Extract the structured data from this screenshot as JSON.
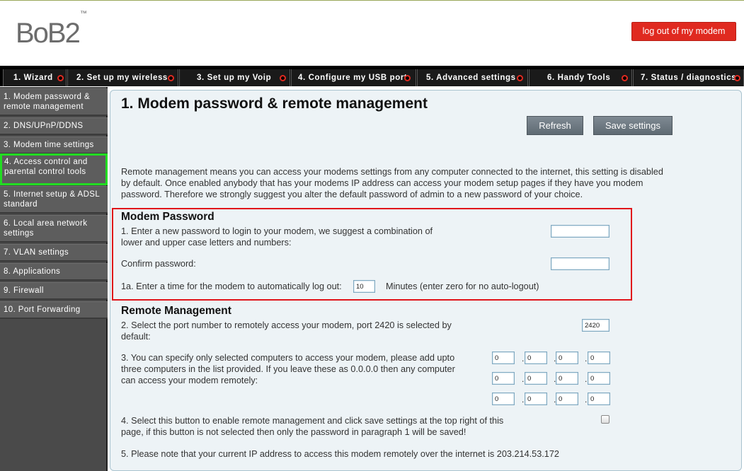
{
  "header": {
    "logo_text": "BoB2",
    "logo_tm": "™",
    "logout_label": "log out of my modem"
  },
  "nav": {
    "tabs": [
      {
        "label": "1. Wizard"
      },
      {
        "label": "2. Set up my wireless"
      },
      {
        "label": "3. Set up my Voip"
      },
      {
        "label": "4. Configure my USB port"
      },
      {
        "label": "5. Advanced settings"
      },
      {
        "label": "6. Handy Tools"
      },
      {
        "label": "7. Status / diagnostics"
      }
    ]
  },
  "sidebar": {
    "items": [
      {
        "label": "1. Modem password & remote management"
      },
      {
        "label": "2. DNS/UPnP/DDNS"
      },
      {
        "label": "3. Modem time settings"
      },
      {
        "label": "4. Access control and parental control tools"
      },
      {
        "label": "5. Internet setup & ADSL standard"
      },
      {
        "label": "6. Local area network settings"
      },
      {
        "label": "7. VLAN settings"
      },
      {
        "label": "8. Applications"
      },
      {
        "label": "9. Firewall"
      },
      {
        "label": "10. Port Forwarding"
      }
    ]
  },
  "main": {
    "title": "1. Modem password & remote management",
    "refresh_label": "Refresh",
    "save_label": "Save settings",
    "intro": "Remote management means you can access your modems settings from any computer connected to the internet, this setting is disabled by default. Once enabled anybody that has your modems IP address can access your modem setup pages if they have you modem password. Therefore we strongly suggest you alter the default password of admin to a new password of your choice.",
    "modem_password": {
      "heading": "Modem Password",
      "new_password_text": "1. Enter a new password to login to your modem, we suggest a combination of lower and upper case letters and numbers:",
      "new_password_value": "",
      "confirm_text": "Confirm password:",
      "confirm_value": "",
      "logout_prefix": "1a. Enter a time for the modem to automatically log out:",
      "logout_value": "10",
      "logout_suffix": "Minutes (enter zero for no auto-logout)"
    },
    "remote": {
      "heading": "Remote Management",
      "port_text": "2. Select the port number to remotely access your modem, port 2420 is selected by default:",
      "port_value": "2420",
      "computers_text": "3. You can specify only selected computers to access your modem, please add upto three computers in the list provided. If you leave these as 0.0.0.0 then any computer can access your modem remotely:",
      "ip_rows": [
        [
          "0",
          "0",
          "0",
          "0"
        ],
        [
          "0",
          "0",
          "0",
          "0"
        ],
        [
          "0",
          "0",
          "0",
          "0"
        ]
      ],
      "enable_text": "4. Select this button to enable remote management and click save settings at the top right of this page, if this button is not selected then only the password in paragraph 1 will be saved!",
      "enable_checked": false,
      "ip_note": "5. Please note that your current IP address to access this modem remotely over the internet is 203.214.53.172"
    }
  },
  "colors": {
    "logout_red": "#e02a20",
    "nav_black": "#000000",
    "sidebar_grey": "#5d5d5d",
    "active_green": "#22dd22",
    "panel_bg": "#edf3f6",
    "highlight_red": "#e0141a"
  }
}
